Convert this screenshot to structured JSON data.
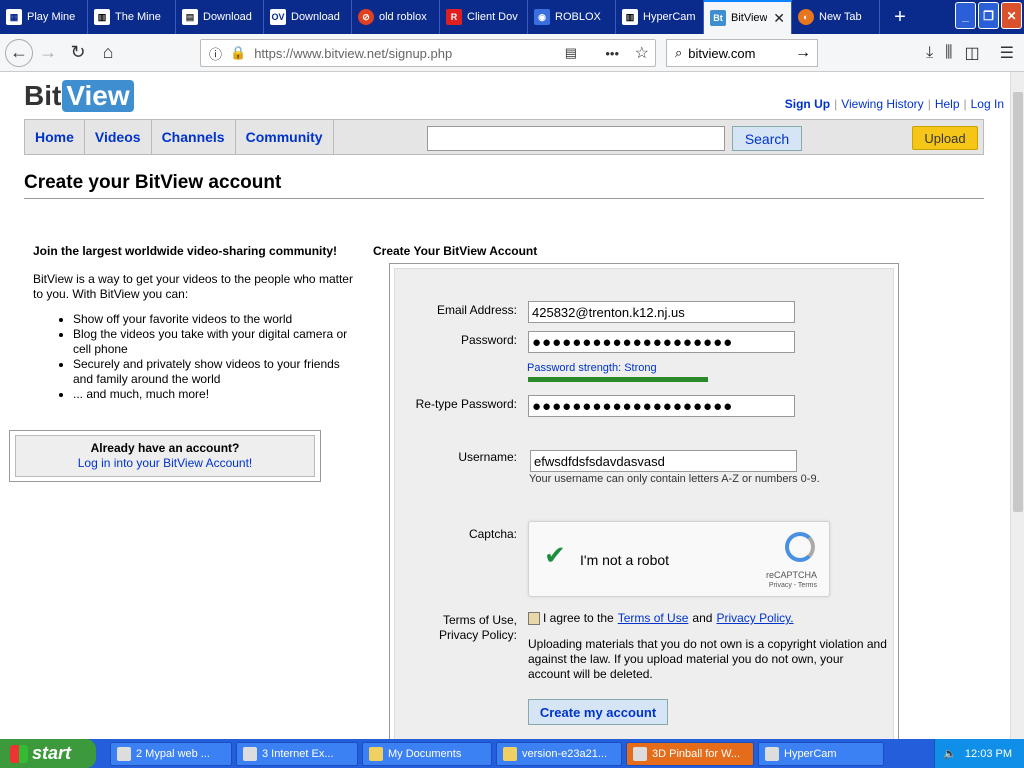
{
  "browser": {
    "tabs": [
      {
        "title": "Play Mine",
        "icon": "grid-icon",
        "active": false
      },
      {
        "title": "The Mine",
        "icon": "building-icon",
        "active": false
      },
      {
        "title": "Download",
        "icon": "document-icon",
        "active": false
      },
      {
        "title": "Download",
        "icon": "ov-icon",
        "active": false
      },
      {
        "title": "old roblox",
        "icon": "no-icon",
        "active": false
      },
      {
        "title": "Client Dov",
        "icon": "r-icon",
        "active": false
      },
      {
        "title": "ROBLOX",
        "icon": "eye-icon",
        "active": false
      },
      {
        "title": "HyperCam",
        "icon": "building-icon",
        "active": false
      },
      {
        "title": "BitView",
        "icon": "bitview-icon",
        "active": true
      },
      {
        "title": "New Tab",
        "icon": "firefox-icon",
        "active": false
      }
    ],
    "url_host": "https://www.bitview.net",
    "url_path": "/signup.php",
    "search_value": "bitview.com"
  },
  "site": {
    "logo_bit": "Bit",
    "logo_view": "View",
    "toplinks": {
      "signup": "Sign Up",
      "history": "Viewing History",
      "help": "Help",
      "login": "Log In"
    },
    "nav": {
      "home": "Home",
      "videos": "Videos",
      "channels": "Channels",
      "community": "Community",
      "search_button": "Search",
      "upload_button": "Upload"
    },
    "page_title": "Create your BitView account"
  },
  "left": {
    "heading": "Join the largest worldwide video-sharing community!",
    "intro": "BitView is a way to get your videos to the people who matter to you. With BitView you can:",
    "bullets": [
      "Show off your favorite videos to the world",
      "Blog the videos you take with your digital camera or cell phone",
      "Securely and privately show videos to your friends and family around the world",
      "... and much, much more!"
    ],
    "already_title": "Already have an account?",
    "already_link": "Log in into your BitView Account!"
  },
  "form": {
    "heading": "Create Your BitView Account",
    "email_label": "Email Address:",
    "email_value": "425832@trenton.k12.nj.us",
    "password_label": "Password:",
    "password_value": "●●●●●●●●●●●●●●●●●●●●",
    "strength_text": "Password strength: Strong",
    "strength_color": "#2a8a2a",
    "retype_label": "Re-type Password:",
    "retype_value": "●●●●●●●●●●●●●●●●●●●●",
    "username_label": "Username:",
    "username_value": "efwsdfdsfsdavdasvasd",
    "username_hint": "Your username can only contain letters A-Z or numbers 0-9.",
    "captcha_label": "Captcha:",
    "captcha_text": "I'm not a robot",
    "captcha_brand": "reCAPTCHA",
    "captcha_links": "Privacy - Terms",
    "terms_label_1": "Terms of Use,",
    "terms_label_2": "Privacy Policy:",
    "agree_prefix": "I agree to the",
    "agree_terms": "Terms of Use",
    "agree_and": "and",
    "agree_privacy": "Privacy Policy.",
    "warning": "Uploading materials that you do not own is a copyright violation and against the law. If you upload material you do not own, your account will be deleted.",
    "create_button": "Create my account"
  },
  "taskbar": {
    "start": "start",
    "items": [
      {
        "label": "2 Mypal web ...",
        "width": 122
      },
      {
        "label": "3 Internet Ex...",
        "width": 122
      },
      {
        "label": "My Documents",
        "width": 130
      },
      {
        "label": "version-e23a21...",
        "width": 126
      },
      {
        "label": "3D Pinball for W...",
        "width": 128
      },
      {
        "label": "HyperCam",
        "width": 126
      }
    ],
    "clock": "12:03 PM"
  }
}
